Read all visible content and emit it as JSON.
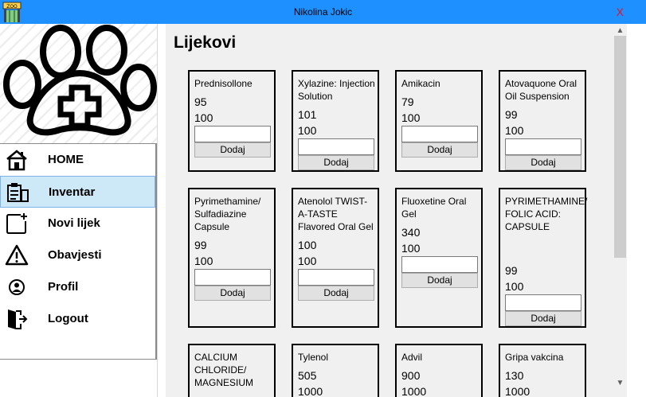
{
  "window": {
    "title": "Nikolina Jokic",
    "close_label": "X",
    "app_icon": "zoo-icon",
    "app_icon_text": "ZOO",
    "accent_color": "#1e90ff"
  },
  "sidebar": {
    "logo": "paw-cross-logo",
    "items": [
      {
        "label": "HOME",
        "icon": "home-icon"
      },
      {
        "label": "Inventar",
        "icon": "inventory-icon",
        "active": true
      },
      {
        "label": "Novi lijek",
        "icon": "add-medicine-icon"
      },
      {
        "label": "Obavjesti",
        "icon": "warning-icon"
      },
      {
        "label": "Profil",
        "icon": "user-icon"
      },
      {
        "label": "Logout",
        "icon": "logout-icon"
      }
    ]
  },
  "main": {
    "title": "Lijekovi",
    "add_label": "Dodaj",
    "cards": [
      {
        "name": "Prednisollone",
        "v1": "95",
        "v2": "100"
      },
      {
        "name": "Xylazine: Injection Solution",
        "v1": "101",
        "v2": "100"
      },
      {
        "name": "Amikacin",
        "v1": "79",
        "v2": "100"
      },
      {
        "name": "Atovaquone Oral Oil Suspension",
        "v1": "99",
        "v2": "100"
      },
      {
        "name": "Pyrimethamine/ Sulfadiazine Capsule",
        "v1": "99",
        "v2": "100"
      },
      {
        "name": "Atenolol TWIST-A-TASTE Flavored Oral Gel",
        "v1": "100",
        "v2": "100"
      },
      {
        "name": "Fluoxetine Oral Gel",
        "v1": "340",
        "v2": "100"
      },
      {
        "name": "PYRIMETHAMINE/ FOLIC ACID: CAPSULE",
        "v1": "99",
        "v2": "100"
      },
      {
        "name": "CALCIUM CHLORIDE/ MAGNESIUM",
        "v1": "",
        "v2": ""
      },
      {
        "name": "Tylenol",
        "v1": "505",
        "v2": "1000"
      },
      {
        "name": "Advil",
        "v1": "900",
        "v2": "1000"
      },
      {
        "name": "Gripa vakcina",
        "v1": "130",
        "v2": "1000"
      }
    ]
  },
  "scrollbar": {
    "up": "▲",
    "down": "▼"
  }
}
